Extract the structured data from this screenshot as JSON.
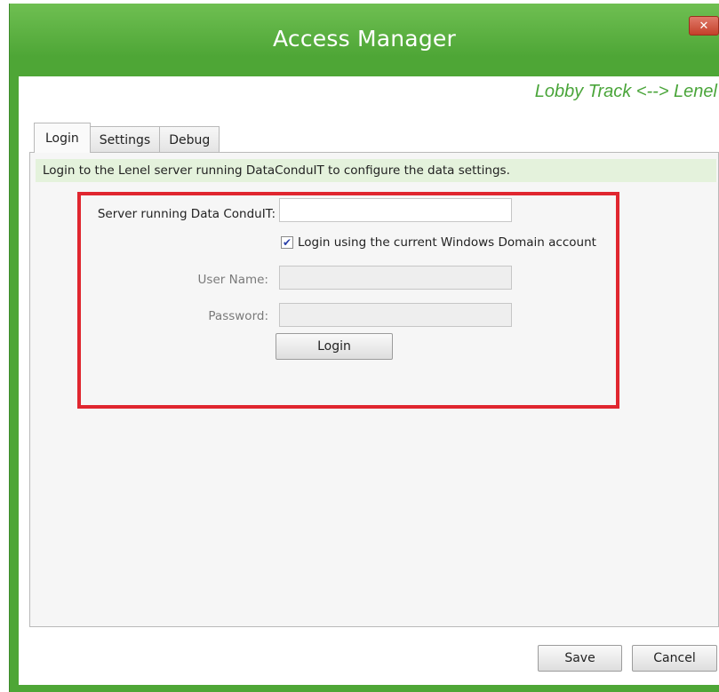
{
  "window": {
    "title": "Access Manager",
    "close_glyph": "✕",
    "subtitle": "Lobby Track <--> Lenel"
  },
  "tabs": [
    {
      "label": "Login",
      "active": true
    },
    {
      "label": "Settings",
      "active": false
    },
    {
      "label": "Debug",
      "active": false
    }
  ],
  "login": {
    "info_text": "Login to the Lenel server running DataConduIT to configure the data settings.",
    "server_label": "Server running Data ConduIT:",
    "server_value": "",
    "use_windows_login_label": "Login using the current Windows Domain account",
    "use_windows_login_checked": true,
    "check_glyph": "✔",
    "username_label": "User Name:",
    "username_value": "",
    "password_label": "Password:",
    "password_value": "",
    "login_button": "Login"
  },
  "footer": {
    "save_label": "Save",
    "cancel_label": "Cancel"
  },
  "colors": {
    "window_chrome": "#4ea636",
    "subtitle": "#4aa53a",
    "info_bar": "#e4f2dc",
    "highlight_box": "#e0262f"
  }
}
